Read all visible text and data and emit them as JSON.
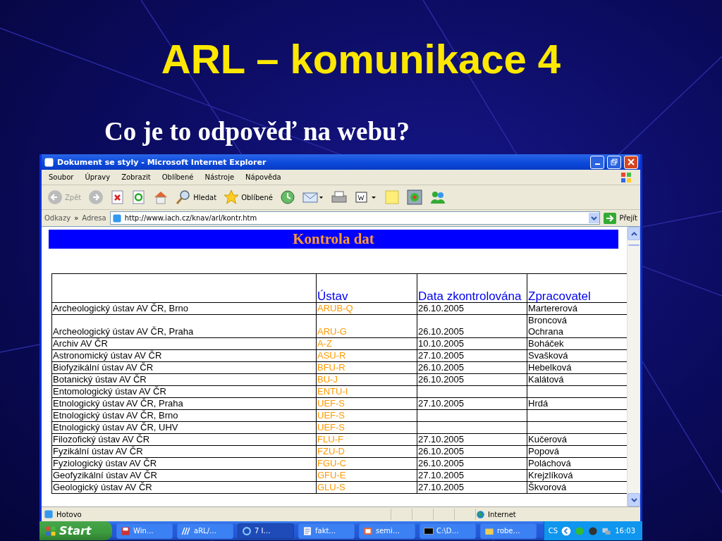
{
  "slide": {
    "title": "ARL – komunikace 4",
    "subtitle": "Co je to odpověď na webu?"
  },
  "window": {
    "title": "Dokument se styly - Microsoft Internet Explorer"
  },
  "menu": [
    "Soubor",
    "Úpravy",
    "Zobrazit",
    "Oblíbené",
    "Nástroje",
    "Nápověda"
  ],
  "toolbar": {
    "back": {
      "label": "Zpět",
      "disabled": true
    },
    "search": "Hledat",
    "favorites": "Oblíbené"
  },
  "address_bar": {
    "links": "Odkazy",
    "chevron": "»",
    "label": "Adresa",
    "value": "http://www.iach.cz/knav/arl/kontr.htm",
    "go": "Přejít"
  },
  "page": {
    "heading": "Kontrola dat",
    "table": {
      "columns": [
        "Ústav",
        "Data zkontrolována",
        "Zpracovatel"
      ],
      "rows": [
        {
          "name": "Archeologický ústav AV ČR, Brno",
          "code": "ARUB-Q",
          "date": "26.10.2005",
          "person": [
            "Martererová"
          ]
        },
        {
          "name": "Archeologický ústav AV ČR, Praha",
          "code": "ARU-G",
          "date": "26.10.2005",
          "person": [
            "Broncová",
            "Ochrana"
          ]
        },
        {
          "name": "Archiv AV ČR",
          "code": "A-Z",
          "date": "10.10.2005",
          "person": [
            "Boháček"
          ]
        },
        {
          "name": "Astronomický ústav AV ČR",
          "code": "ASU-R",
          "date": "27.10.2005",
          "person": [
            "Svašková"
          ]
        },
        {
          "name": "Biofyzikální ústav AV ČR",
          "code": "BFU-R",
          "date": "26.10.2005",
          "person": [
            "Hebelková"
          ]
        },
        {
          "name": "Botanický ústav AV ČR",
          "code": "BU-J",
          "date": "26.10.2005",
          "person": [
            "Kalátová"
          ]
        },
        {
          "name": "Entomologický ústav AV ČR",
          "code": "ENTU-I"
        },
        {
          "name": "Etnologický ústav AV ČR, Praha",
          "code": "UEF-S",
          "date": "27.10.2005",
          "person": [
            "Hrdá"
          ]
        },
        {
          "name": "Etnologický ústav AV ČR, Brno",
          "code": "UEF-S"
        },
        {
          "name": "Etnologický ústav AV ČR, UHV",
          "code": "UEF-S"
        },
        {
          "name": "Filozofický ústav AV ČR",
          "code": "FLU-F",
          "date": "27.10.2005",
          "person": [
            "Kučerová"
          ]
        },
        {
          "name": "Fyzikální ústav AV ČR",
          "code": "FZU-D",
          "date": "26.10.2005",
          "person": [
            "Popová"
          ]
        },
        {
          "name": "Fyziologický ústav AV ČR",
          "code": "FGU-C",
          "date": "26.10.2005",
          "person": [
            "Poláchová"
          ]
        },
        {
          "name": "Geofyzikální ústav AV ČR",
          "code": "GFU-E",
          "date": "27.10.2005",
          "person": [
            "Krejzlíková"
          ]
        },
        {
          "name": "Geologický ústav AV ČR",
          "code": "GLU-S",
          "date": "27.10.2005",
          "person": [
            "Škvorová"
          ]
        }
      ]
    }
  },
  "status_bar": {
    "text": "Hotovo",
    "zone": "Internet"
  },
  "taskbar": {
    "start": "Start",
    "items": [
      {
        "label": "Win…",
        "kind": "disk",
        "selected": false
      },
      {
        "label": "aRL/…",
        "kind": "slashes",
        "selected": false
      },
      {
        "label": "7 I…",
        "kind": "ie",
        "selected": true
      },
      {
        "label": "fakt…",
        "kind": "word",
        "selected": false
      },
      {
        "label": "semi…",
        "kind": "slides",
        "selected": false
      },
      {
        "label": "C:\\D…",
        "kind": "console",
        "selected": false
      },
      {
        "label": "robe…",
        "kind": "folder",
        "selected": false
      }
    ],
    "language": "CS",
    "clock": "16:03"
  }
}
